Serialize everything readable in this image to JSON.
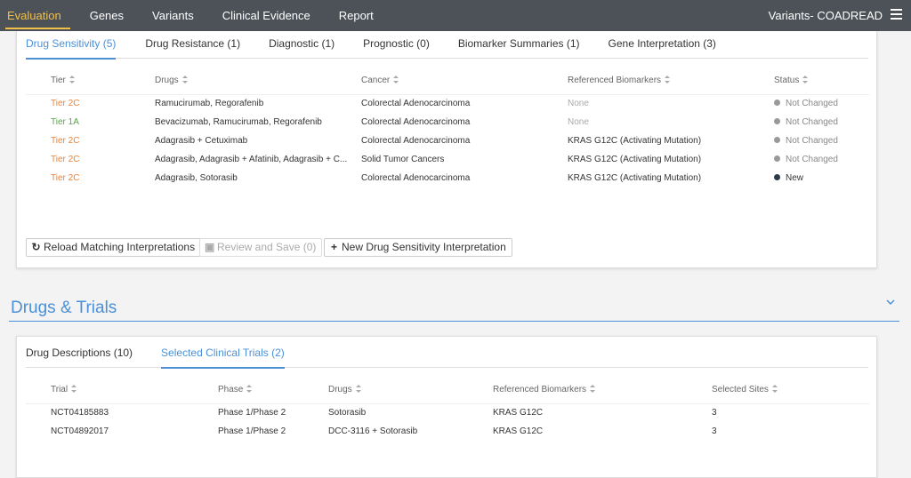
{
  "nav": {
    "items": [
      {
        "label": "Evaluation",
        "active": true
      },
      {
        "label": "Genes"
      },
      {
        "label": "Variants"
      },
      {
        "label": "Clinical Evidence"
      },
      {
        "label": "Report"
      }
    ],
    "title": "Variants- COADREAD",
    "menu_icon": "hamburger-menu-icon"
  },
  "interpretations": {
    "tabs": [
      {
        "label": "Drug Sensitivity (5)",
        "active": true
      },
      {
        "label": "Drug Resistance (1)"
      },
      {
        "label": "Diagnostic (1)"
      },
      {
        "label": "Prognostic (0)"
      },
      {
        "label": "Biomarker Summaries (1)"
      },
      {
        "label": "Gene Interpretation (3)"
      }
    ],
    "columns": [
      "Tier",
      "Drugs",
      "Cancer",
      "Referenced Biomarkers",
      "Status"
    ],
    "rows": [
      {
        "tier": "Tier 2C",
        "drugs": "Ramucirumab, Regorafenib",
        "cancer": "Colorectal Adenocarcinoma",
        "biomarkers": "None",
        "status": "Not Changed"
      },
      {
        "tier": "Tier 1A",
        "drugs": "Bevacizumab, Ramucirumab, Regorafenib",
        "cancer": "Colorectal Adenocarcinoma",
        "biomarkers": "None",
        "status": "Not Changed"
      },
      {
        "tier": "Tier 2C",
        "drugs": "Adagrasib + Cetuximab",
        "cancer": "Colorectal Adenocarcinoma",
        "biomarkers": "KRAS G12C (Activating Mutation)",
        "status": "Not Changed"
      },
      {
        "tier": "Tier 2C",
        "drugs": "Adagrasib, Adagrasib + Afatinib, Adagrasib + C...",
        "cancer": "Solid Tumor Cancers",
        "biomarkers": "KRAS G12C (Activating Mutation)",
        "status": "Not Changed"
      },
      {
        "tier": "Tier 2C",
        "drugs": "Adagrasib, Sotorasib",
        "cancer": "Colorectal Adenocarcinoma",
        "biomarkers": "KRAS G12C (Activating Mutation)",
        "status": "New"
      }
    ],
    "colors": {
      "tier_2c": "#e8833a",
      "tier_1a": "#5aa64a",
      "accent": "#4a90d9"
    },
    "buttons": {
      "reload": "Reload Matching Interpretations",
      "review": "Review and Save (0)",
      "new": "New Drug Sensitivity Interpretation"
    }
  },
  "drugs_trials": {
    "title": "Drugs & Trials",
    "tabs": [
      {
        "label": "Drug Descriptions (10)"
      },
      {
        "label": "Selected Clinical Trials (2)",
        "active": true
      }
    ],
    "columns": [
      "Trial",
      "Phase",
      "Drugs",
      "Referenced Biomarkers",
      "Selected Sites"
    ],
    "rows": [
      {
        "trial": "NCT04185883",
        "phase": "Phase 1/Phase 2",
        "drugs": "Sotorasib",
        "biomarkers": "KRAS G12C",
        "sites": "3"
      },
      {
        "trial": "NCT04892017",
        "phase": "Phase 1/Phase 2",
        "drugs": "DCC-3116 + Sotorasib",
        "biomarkers": "KRAS G12C",
        "sites": "3"
      }
    ]
  }
}
